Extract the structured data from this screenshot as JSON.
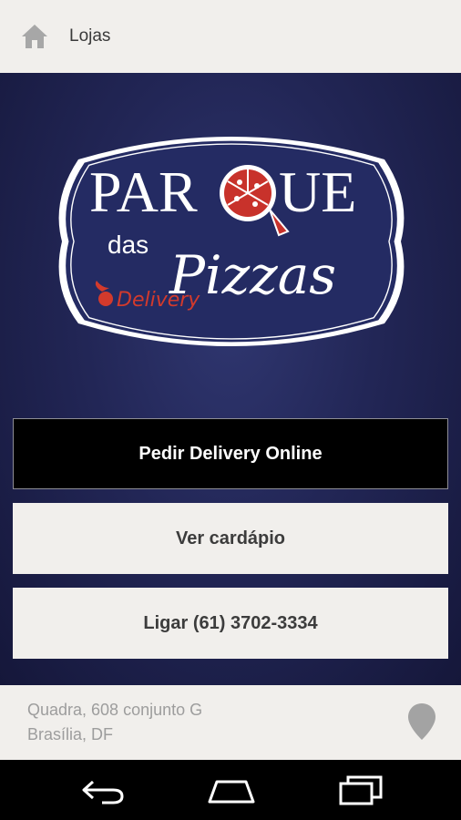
{
  "topbar": {
    "title": "Lojas",
    "home_icon": "home-icon"
  },
  "logo": {
    "line1_left": "PAR",
    "line1_right": "UE",
    "das": "das",
    "pizzas": "Pizzas",
    "delivery": "Delivery",
    "colors": {
      "navy": "#242b63",
      "white": "#ffffff",
      "red": "#d33a2c"
    }
  },
  "buttons": {
    "delivery": "Pedir Delivery Online",
    "menu": "Ver cardápio",
    "call": "Ligar (61) 3702-3334"
  },
  "address": {
    "line1": "Quadra, 608 conjunto G",
    "line2": "Brasília, DF",
    "pin_icon": "map-pin-icon"
  },
  "navbar": {
    "icons": [
      "back-icon",
      "home-nav-icon",
      "recent-apps-icon"
    ]
  }
}
